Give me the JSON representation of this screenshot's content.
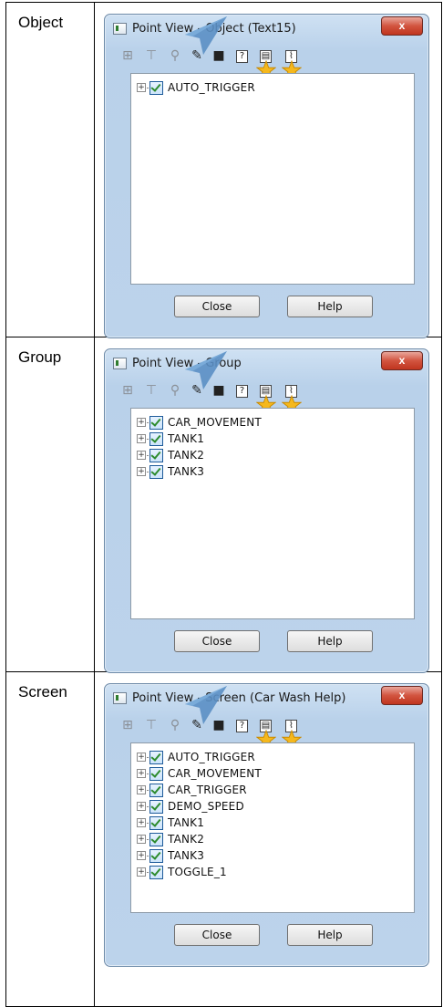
{
  "rows": [
    {
      "label": "Object",
      "window": {
        "title": "Point View - Object (Text15)",
        "close_x": "x",
        "items": [
          "AUTO_TRIGGER"
        ],
        "close_label": "Close",
        "help_label": "Help"
      }
    },
    {
      "label": "Group",
      "window": {
        "title": "Point View - Group",
        "close_x": "x",
        "items": [
          "CAR_MOVEMENT",
          "TANK1",
          "TANK2",
          "TANK3"
        ],
        "close_label": "Close",
        "help_label": "Help"
      }
    },
    {
      "label": "Screen",
      "window": {
        "title": "Point View - Screen (Car Wash Help)",
        "close_x": "x",
        "items": [
          "AUTO_TRIGGER",
          "CAR_MOVEMENT",
          "CAR_TRIGGER",
          "DEMO_SPEED",
          "TANK1",
          "TANK2",
          "TANK3",
          "TOGGLE_1"
        ],
        "close_label": "Close",
        "help_label": "Help"
      }
    }
  ],
  "toolbar_icons": [
    "properties-icon",
    "tree-icon",
    "pointer-icon",
    "tools-icon",
    "copy-icon",
    "help-icon",
    "trend-icon",
    "chart-icon"
  ],
  "colors": {
    "accent_star": "#f5b81d",
    "pointer_blue": "#5b8fc4",
    "close_red": "#c9432e"
  }
}
